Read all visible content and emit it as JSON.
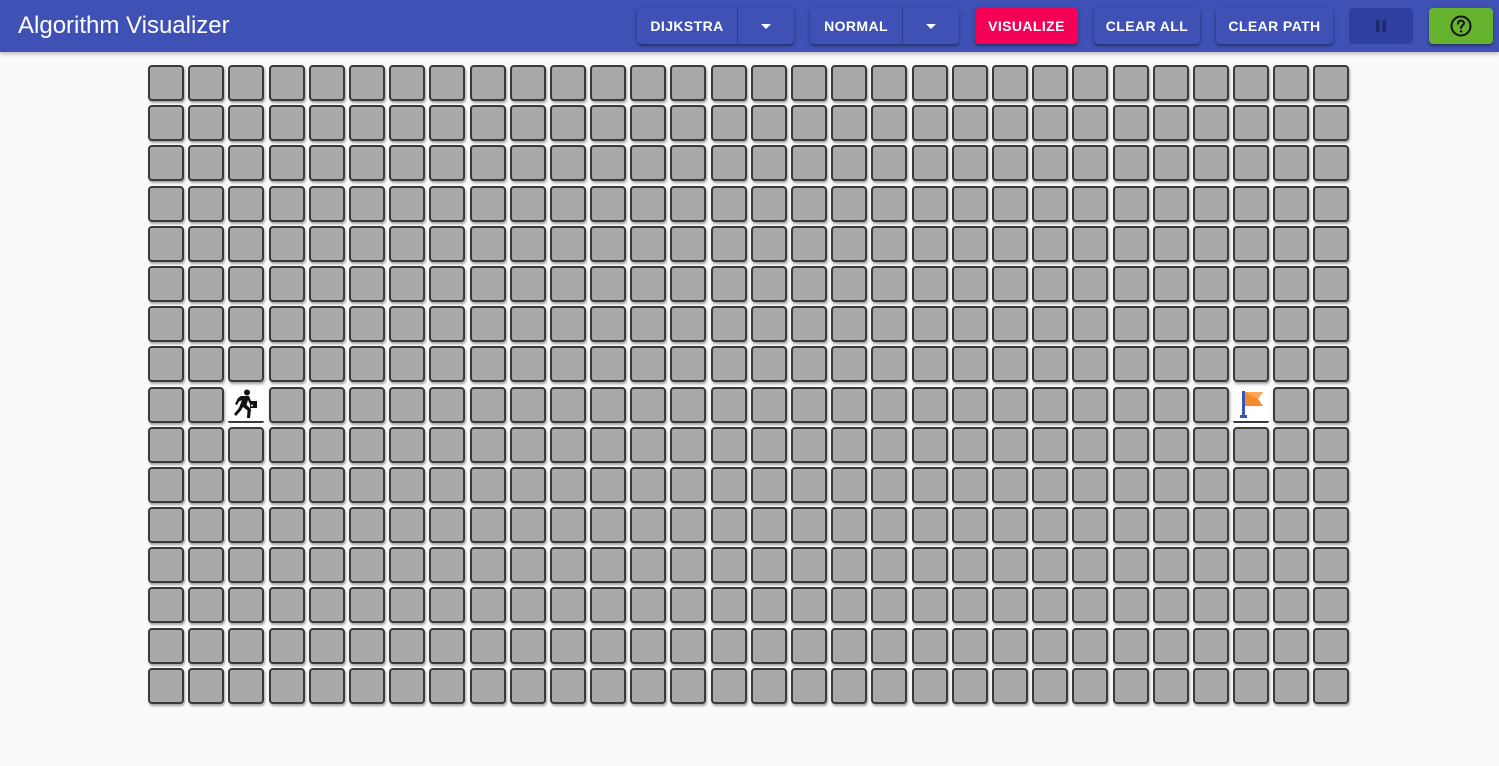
{
  "app": {
    "title": "Algorithm Visualizer"
  },
  "toolbar": {
    "algorithm_label": "DIJKSTRA",
    "speed_label": "NORMAL",
    "visualize_label": "VISUALIZE",
    "clear_all_label": "CLEAR ALL",
    "clear_path_label": "CLEAR PATH",
    "pause_icon": "pause-icon",
    "help_icon": "help-icon",
    "dropdown_icon": "chevron-down-icon"
  },
  "grid": {
    "rows": 16,
    "cols": 30,
    "start_node": {
      "row": 8,
      "col": 2,
      "icon": "runner-icon"
    },
    "end_node": {
      "row": 8,
      "col": 27,
      "icon": "flag-icon"
    }
  },
  "colors": {
    "appbar": "#3f51b5",
    "visualize_button": "#f50057",
    "pause_button": "#303f9f",
    "help_button": "#64b22e",
    "cell": "#aba8a8",
    "cell_border": "#3a3a3a",
    "flag": "#f58a2b",
    "flag_pole": "#3a55b5"
  }
}
